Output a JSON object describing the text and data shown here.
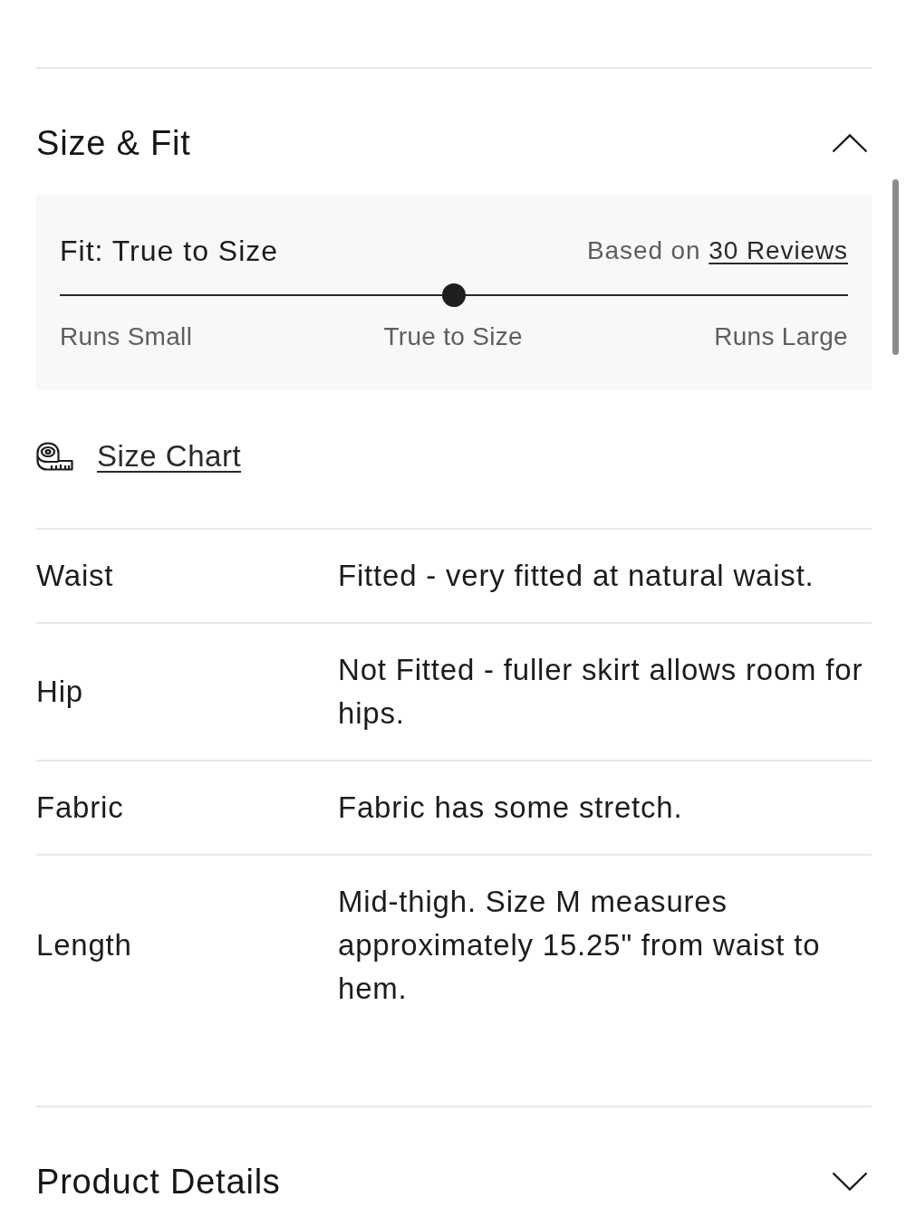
{
  "size_fit": {
    "title": "Size & Fit",
    "expanded": true,
    "fit": {
      "title": "Fit: True to Size",
      "based_on": "Based on",
      "reviews_link": "30 Reviews",
      "level": 0.5,
      "scale_labels": [
        "Runs Small",
        "True to Size",
        "Runs Large"
      ]
    },
    "size_chart_link": "Size Chart",
    "attributes": [
      {
        "label": "Waist",
        "value": "Fitted - very fitted at natural waist."
      },
      {
        "label": "Hip",
        "value": "Not Fitted - fuller skirt allows room for hips."
      },
      {
        "label": "Fabric",
        "value": "Fabric has some stretch."
      },
      {
        "label": "Length",
        "value": "Mid-thigh. Size M measures approximately 15.25\" from waist to hem."
      }
    ]
  },
  "product_details": {
    "title": "Product Details",
    "expanded": false
  }
}
